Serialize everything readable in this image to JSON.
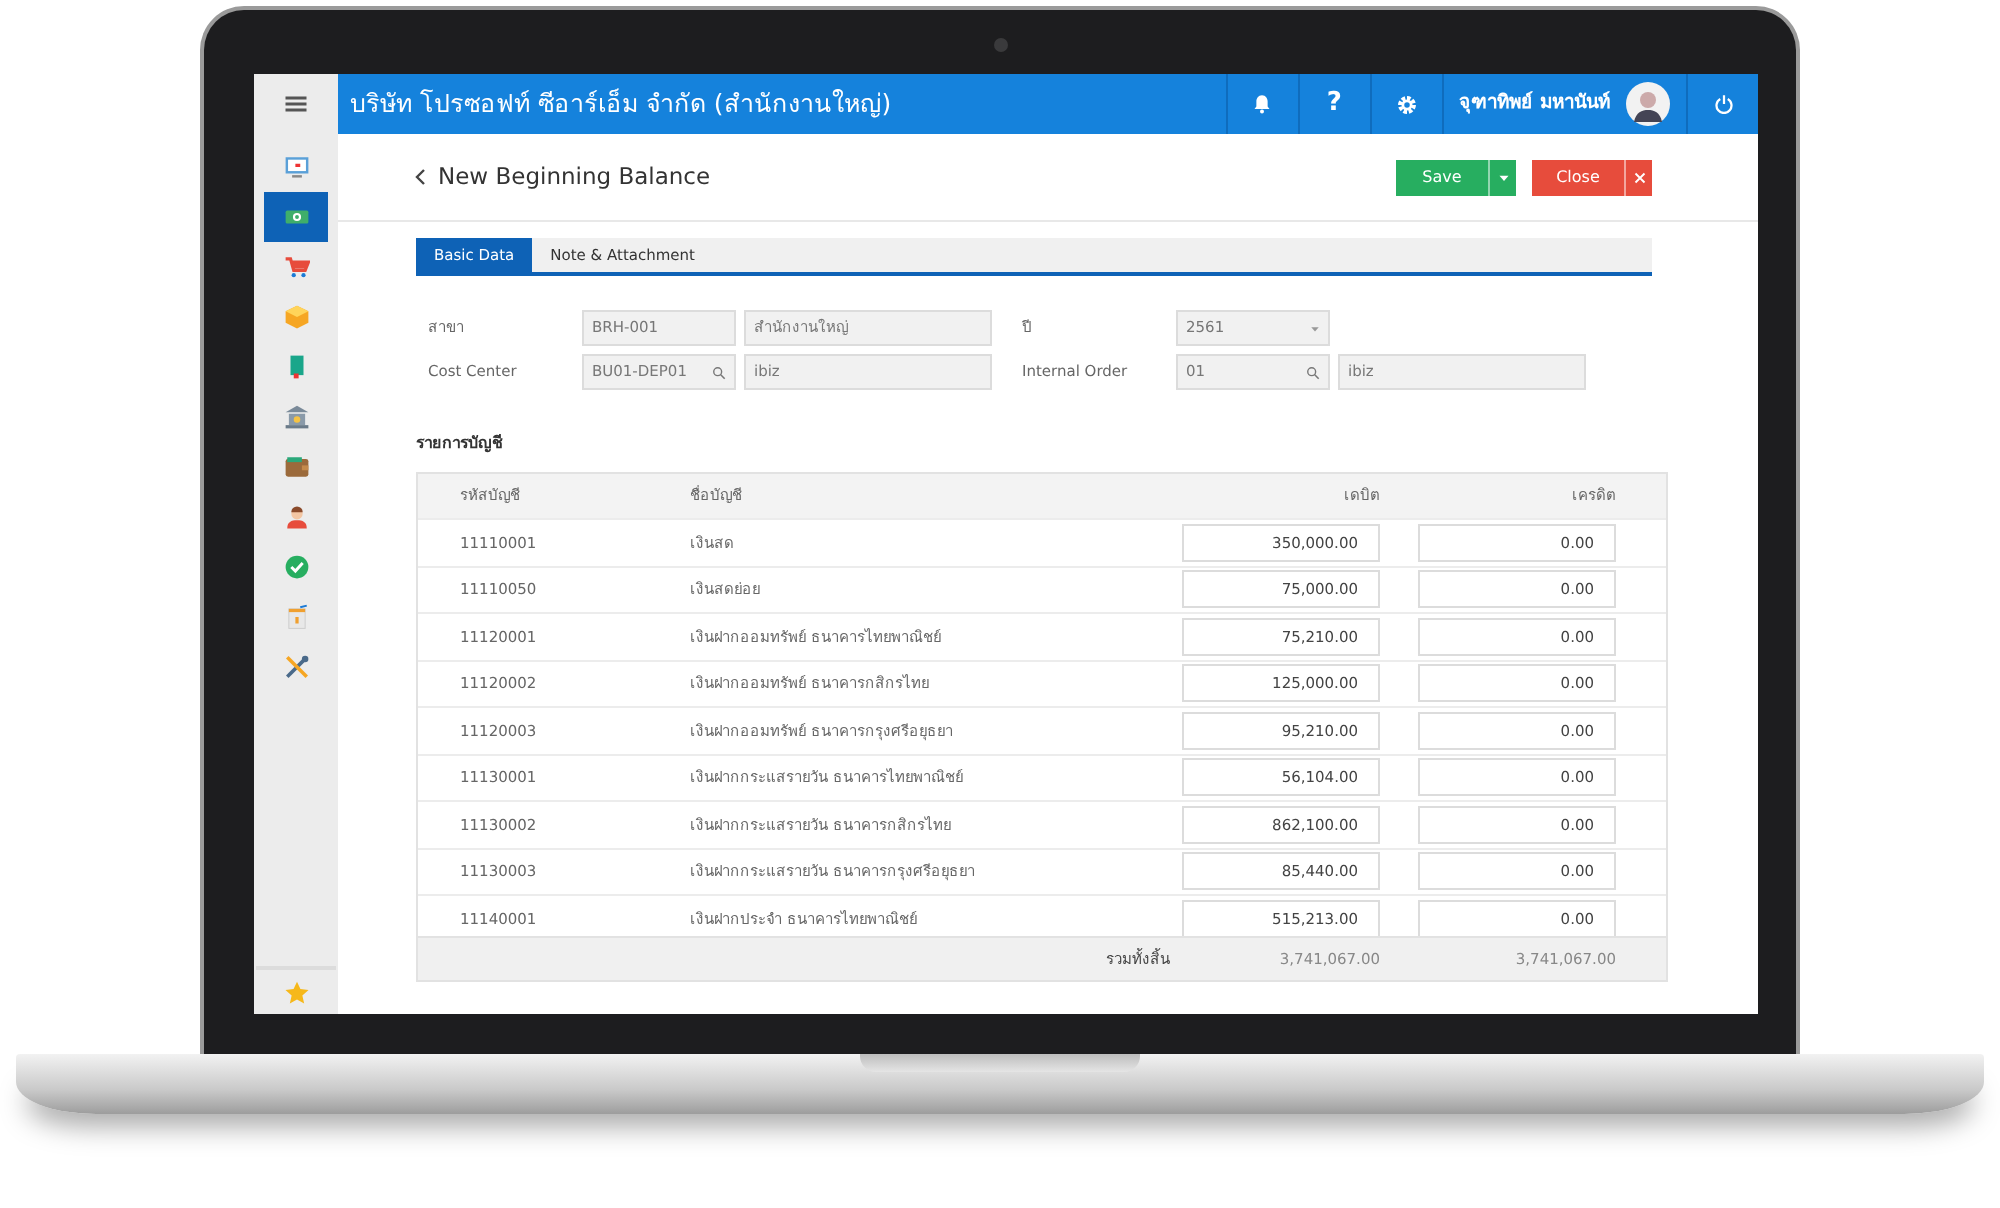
{
  "topbar": {
    "company": "บริษัท โปรซอฟท์ ซีอาร์เอ็ม จำกัด (สำนักงานใหญ่)",
    "help": "?",
    "user": "จุฑาทิพย์ มหานันท์"
  },
  "sidebar": {
    "items": [
      {
        "kind": "monitor",
        "selected": false
      },
      {
        "kind": "money",
        "selected": true
      },
      {
        "kind": "cart",
        "selected": false
      },
      {
        "kind": "box",
        "selected": false
      },
      {
        "kind": "book",
        "selected": false
      },
      {
        "kind": "bank",
        "selected": false
      },
      {
        "kind": "wallet",
        "selected": false
      },
      {
        "kind": "person",
        "selected": false
      },
      {
        "kind": "check",
        "selected": false
      },
      {
        "kind": "calendar",
        "selected": false
      },
      {
        "kind": "tools",
        "selected": false
      }
    ],
    "bottom": {
      "kind": "star"
    }
  },
  "page": {
    "title": "New Beginning Balance",
    "buttons": [
      {
        "label": "Save",
        "kind": "save"
      },
      {
        "label": "Close",
        "kind": "close"
      }
    ]
  },
  "tabs": [
    {
      "label": "Basic Data",
      "selected": true
    },
    {
      "label": "Note & Attachment",
      "selected": false
    }
  ],
  "form": {
    "rows": [
      {
        "label": "สาขา",
        "fields": [
          {
            "kind": "text",
            "value": "BRH-001"
          },
          {
            "kind": "text",
            "value": "สำนักงานใหญ่"
          }
        ],
        "label2": "ปี",
        "fields2": [
          {
            "kind": "select",
            "value": "2561"
          }
        ]
      },
      {
        "label": "Cost Center",
        "fields": [
          {
            "kind": "search",
            "value": "BU01-DEP01"
          },
          {
            "kind": "text",
            "value": "ibiz"
          }
        ],
        "label2": "Internal Order",
        "fields2": [
          {
            "kind": "search",
            "value": "01"
          },
          {
            "kind": "text",
            "value": "ibiz"
          }
        ]
      }
    ]
  },
  "table": {
    "title": "รายการบัญชี",
    "columns": [
      "รหัสบัญชี",
      "ชื่อบัญชี",
      "เดบิต",
      "เครดิต"
    ],
    "rows": [
      {
        "code": "11110001",
        "name": "เงินสด",
        "debit": "350,000.00",
        "credit": "0.00"
      },
      {
        "code": "11110050",
        "name": "เงินสดย่อย",
        "debit": "75,000.00",
        "credit": "0.00"
      },
      {
        "code": "11120001",
        "name": "เงินฝากออมทรัพย์ ธนาคารไทยพาณิชย์",
        "debit": "75,210.00",
        "credit": "0.00"
      },
      {
        "code": "11120002",
        "name": "เงินฝากออมทรัพย์ ธนาคารกสิกรไทย",
        "debit": "125,000.00",
        "credit": "0.00"
      },
      {
        "code": "11120003",
        "name": "เงินฝากออมทรัพย์ ธนาคารกรุงศรีอยุธยา",
        "debit": "95,210.00",
        "credit": "0.00"
      },
      {
        "code": "11130001",
        "name": "เงินฝากกระแสรายวัน ธนาคารไทยพาณิชย์",
        "debit": "56,104.00",
        "credit": "0.00"
      },
      {
        "code": "11130002",
        "name": "เงินฝากกระแสรายวัน ธนาคารกสิกรไทย",
        "debit": "862,100.00",
        "credit": "0.00"
      },
      {
        "code": "11130003",
        "name": "เงินฝากกระแสรายวัน ธนาคารกรุงศรีอยุธยา",
        "debit": "85,440.00",
        "credit": "0.00"
      },
      {
        "code": "11140001",
        "name": "เงินฝากประจำ ธนาคารไทยพาณิชย์",
        "debit": "515,213.00",
        "credit": "0.00"
      }
    ],
    "total_label": "รวมทั้งสิ้น",
    "total_debit": "3,741,067.00",
    "total_credit": "3,741,067.00"
  }
}
